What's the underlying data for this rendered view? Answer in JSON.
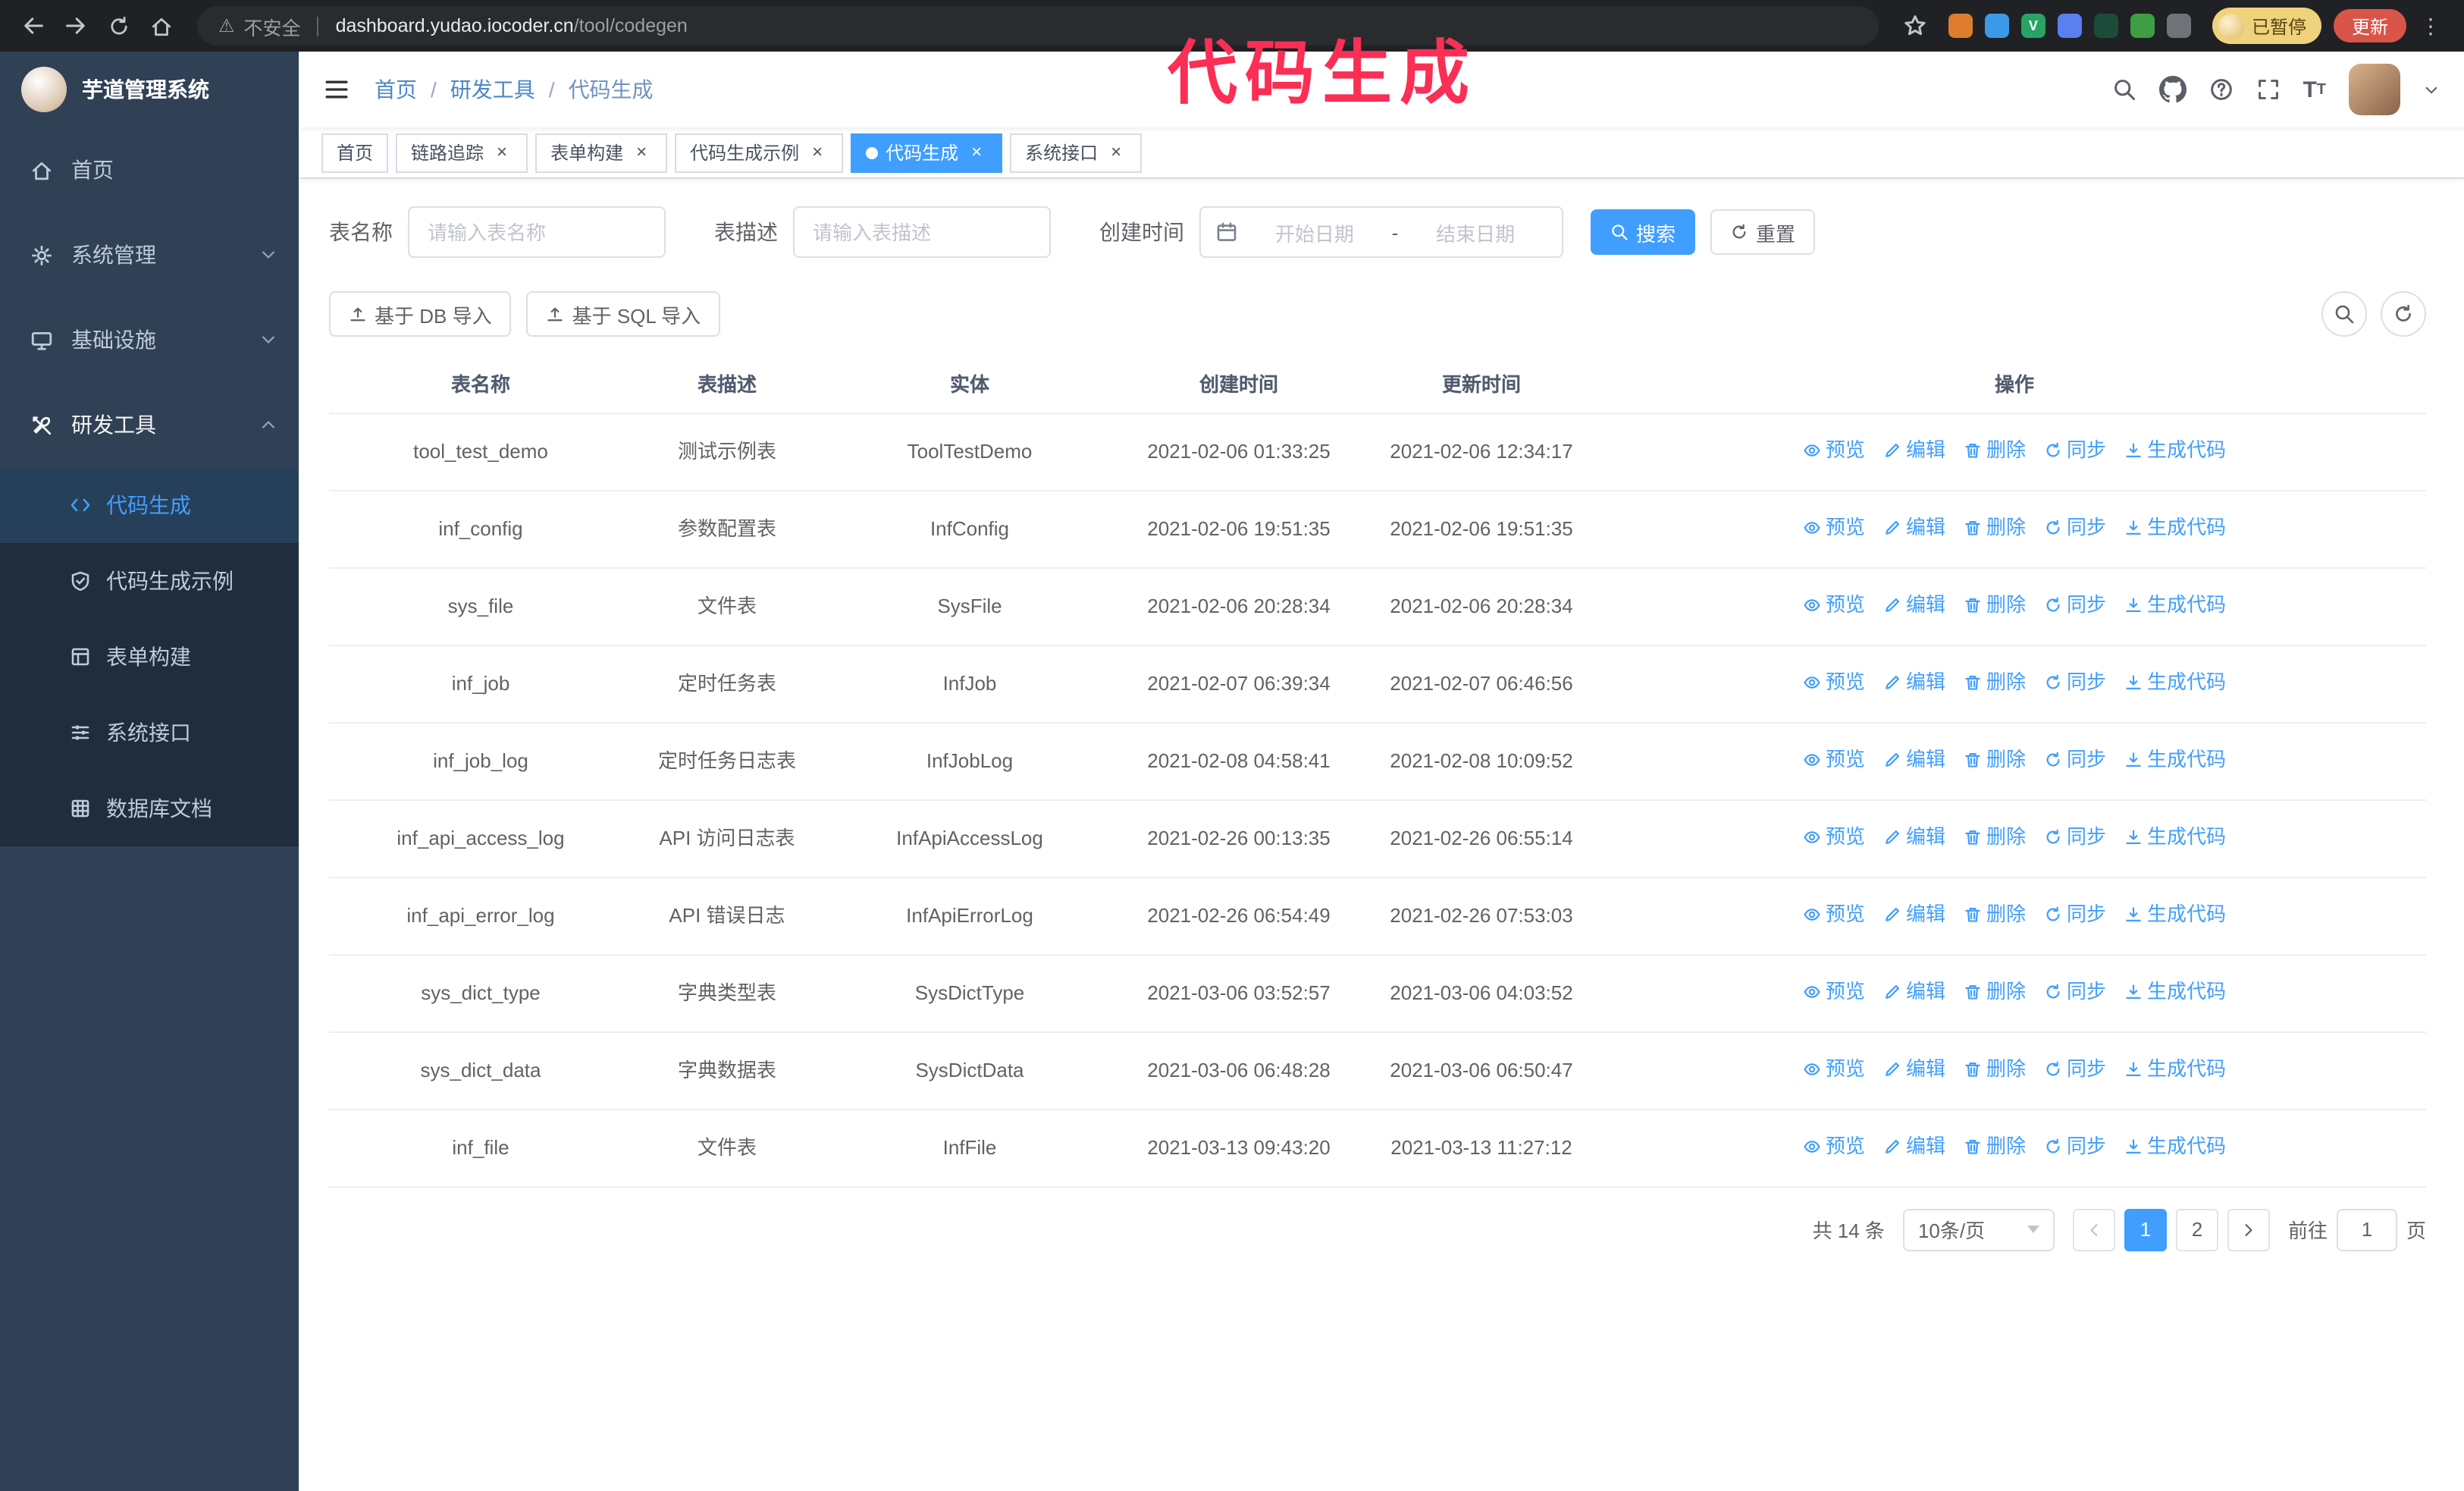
{
  "colors": {
    "accent": "#409eff",
    "sidebar_bg": "#304156",
    "submenu_bg": "#1f2d3d",
    "annotation": "#fb2e55"
  },
  "annotation": {
    "text": "代码生成"
  },
  "browser": {
    "security_label": "不安全",
    "url_host": "dashboard.yudao.iocoder.cn",
    "url_path": "/tool/codegen",
    "paused_badge": "已暂停",
    "update_button": "更新",
    "extensions": [
      {
        "icon": "ext-orange-icon",
        "color": "#de7d2e"
      },
      {
        "icon": "ext-blue-drop-icon",
        "color": "#3b99e8"
      },
      {
        "icon": "ext-green-check-icon",
        "color": "#27a463",
        "glyph": "V"
      },
      {
        "icon": "ext-people-icon",
        "color": "#5b7ff0"
      },
      {
        "icon": "ext-dark-icon",
        "color": "#1d4b3a"
      },
      {
        "icon": "ext-leaf-icon",
        "color": "#3f9d44"
      },
      {
        "icon": "ext-puzzle-icon",
        "color": "#6f7276"
      }
    ]
  },
  "sidebar": {
    "title": "芋道管理系统",
    "menu": [
      {
        "key": "home",
        "label": "首页",
        "icon": "home-icon",
        "chevron": ""
      },
      {
        "key": "system",
        "label": "系统管理",
        "icon": "gear-icon",
        "chevron": "down"
      },
      {
        "key": "infra",
        "label": "基础设施",
        "icon": "infra-icon",
        "chevron": "down"
      },
      {
        "key": "devtools",
        "label": "研发工具",
        "icon": "tools-icon",
        "chevron": "up",
        "active": true
      }
    ],
    "submenu": [
      {
        "key": "codegen",
        "label": "代码生成",
        "icon": "code-icon",
        "active": true
      },
      {
        "key": "codegen-example",
        "label": "代码生成示例",
        "icon": "shield-icon"
      },
      {
        "key": "form-build",
        "label": "表单构建",
        "icon": "form-icon"
      },
      {
        "key": "system-api",
        "label": "系统接口",
        "icon": "sliders-icon"
      },
      {
        "key": "db-doc",
        "label": "数据库文档",
        "icon": "grid-icon"
      }
    ]
  },
  "header": {
    "breadcrumb": [
      "首页",
      "研发工具",
      "代码生成"
    ],
    "separator": "/"
  },
  "tabs": [
    {
      "key": "home",
      "label": "首页",
      "closable": false
    },
    {
      "key": "tracing",
      "label": "链路追踪",
      "closable": true
    },
    {
      "key": "form-build",
      "label": "表单构建",
      "closable": true
    },
    {
      "key": "codegen-example",
      "label": "代码生成示例",
      "closable": true
    },
    {
      "key": "codegen",
      "label": "代码生成",
      "closable": true,
      "active": true
    },
    {
      "key": "system-api",
      "label": "系统接口",
      "closable": true
    }
  ],
  "filters": {
    "table_name_label": "表名称",
    "table_name_placeholder": "请输入表名称",
    "table_desc_label": "表描述",
    "table_desc_placeholder": "请输入表描述",
    "create_time_label": "创建时间",
    "date_start_placeholder": "开始日期",
    "date_separator": "-",
    "date_end_placeholder": "结束日期",
    "search_button": "搜索",
    "reset_button": "重置"
  },
  "toolbar": {
    "import_db": "基于 DB 导入",
    "import_sql": "基于 SQL 导入"
  },
  "table": {
    "columns": [
      "表名称",
      "表描述",
      "实体",
      "创建时间",
      "更新时间",
      "操作"
    ],
    "actions": [
      {
        "key": "preview",
        "label": "预览",
        "icon": "eye-icon"
      },
      {
        "key": "edit",
        "label": "编辑",
        "icon": "edit-icon"
      },
      {
        "key": "delete",
        "label": "删除",
        "icon": "trash-icon"
      },
      {
        "key": "sync",
        "label": "同步",
        "icon": "sync-icon"
      },
      {
        "key": "generate",
        "label": "生成代码",
        "icon": "download-icon"
      }
    ],
    "rows": [
      {
        "name": "tool_test_demo",
        "desc": "测试示例表",
        "entity": "ToolTestDemo",
        "created": "2021-02-06 01:33:25",
        "updated": "2021-02-06 12:34:17"
      },
      {
        "name": "inf_config",
        "desc": "参数配置表",
        "entity": "InfConfig",
        "created": "2021-02-06 19:51:35",
        "updated": "2021-02-06 19:51:35"
      },
      {
        "name": "sys_file",
        "desc": "文件表",
        "entity": "SysFile",
        "created": "2021-02-06 20:28:34",
        "updated": "2021-02-06 20:28:34"
      },
      {
        "name": "inf_job",
        "desc": "定时任务表",
        "entity": "InfJob",
        "created": "2021-02-07 06:39:34",
        "updated": "2021-02-07 06:46:56"
      },
      {
        "name": "inf_job_log",
        "desc": "定时任务日志表",
        "entity": "InfJobLog",
        "created": "2021-02-08 04:58:41",
        "updated": "2021-02-08 10:09:52"
      },
      {
        "name": "inf_api_access_log",
        "desc": "API 访问日志表",
        "entity": "InfApiAccessLog",
        "created": "2021-02-26 00:13:35",
        "updated": "2021-02-26 06:55:14"
      },
      {
        "name": "inf_api_error_log",
        "desc": "API 错误日志",
        "entity": "InfApiErrorLog",
        "created": "2021-02-26 06:54:49",
        "updated": "2021-02-26 07:53:03"
      },
      {
        "name": "sys_dict_type",
        "desc": "字典类型表",
        "entity": "SysDictType",
        "created": "2021-03-06 03:52:57",
        "updated": "2021-03-06 04:03:52"
      },
      {
        "name": "sys_dict_data",
        "desc": "字典数据表",
        "entity": "SysDictData",
        "created": "2021-03-06 06:48:28",
        "updated": "2021-03-06 06:50:47"
      },
      {
        "name": "inf_file",
        "desc": "文件表",
        "entity": "InfFile",
        "created": "2021-03-13 09:43:20",
        "updated": "2021-03-13 11:27:12"
      }
    ]
  },
  "pagination": {
    "total": "共 14 条",
    "page_size": "10条/页",
    "pages": [
      {
        "label": "1",
        "active": true
      },
      {
        "label": "2",
        "active": false
      }
    ],
    "goto_label": "前往",
    "goto_value": "1",
    "goto_suffix": "页"
  }
}
